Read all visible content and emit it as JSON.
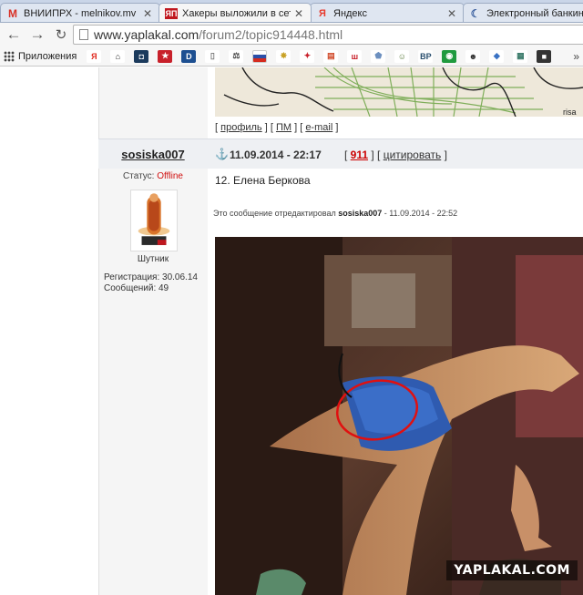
{
  "tabs": [
    {
      "favicon": "gmail-icon",
      "favicon_text": "M",
      "favicon_color": "#d93025",
      "label": "ВНИИПРХ - melnikov.mv",
      "active": false
    },
    {
      "favicon": "yaplakal-icon",
      "favicon_text": "ЯП",
      "favicon_color": "#c0181f",
      "label": "Хакеры выложили в сеть",
      "active": true
    },
    {
      "favicon": "yandex-icon",
      "favicon_text": "Я",
      "favicon_color": "#e83a2d",
      "label": "Яндекс",
      "active": false
    },
    {
      "favicon": "bank-icon",
      "favicon_text": "",
      "favicon_color": "#3a5f9e",
      "label": "Электронный банкинг",
      "active": false
    }
  ],
  "toolbar": {
    "url_host": "www.yaplakal.com",
    "url_path": "/forum2/topic914448.html"
  },
  "bookmarks": {
    "apps_label": "Приложения",
    "items": [
      {
        "icon": "yandex-bookmark-icon",
        "text": "Я",
        "color": "#ffffff",
        "fg": "#e02b20"
      },
      {
        "icon": "home-bookmark-icon",
        "text": "⌂",
        "color": "#ffffff",
        "fg": "#222"
      },
      {
        "icon": "square-bookmark-icon",
        "text": "◘",
        "color": "#1b3a5c",
        "fg": "#fff"
      },
      {
        "icon": "star-bookmark-icon",
        "text": "★",
        "color": "#c8202a",
        "fg": "#fff"
      },
      {
        "icon": "d-bookmark-icon",
        "text": "D",
        "color": "#1d4f91",
        "fg": "#fff"
      },
      {
        "icon": "page-bookmark-icon",
        "text": "▯",
        "color": "#ffffff",
        "fg": "#777"
      },
      {
        "icon": "gavel-bookmark-icon",
        "text": "⚖",
        "color": "#ffffff",
        "fg": "#444"
      },
      {
        "icon": "russia-flag-bookmark-icon",
        "text": "",
        "color": "#3a56a6",
        "fg": "#fff"
      },
      {
        "icon": "emblem-bookmark-icon",
        "text": "✸",
        "color": "#ffffff",
        "fg": "#c9a227"
      },
      {
        "icon": "eagle-bookmark-icon",
        "text": "✦",
        "color": "#ffffff",
        "fg": "#c8202a"
      },
      {
        "icon": "flag-bookmark-icon",
        "text": "▤",
        "color": "#ffffff",
        "fg": "#d04a2a"
      },
      {
        "icon": "w-bookmark-icon",
        "text": "ш",
        "color": "#ffffff",
        "fg": "#c8202a"
      },
      {
        "icon": "shield-bookmark-icon",
        "text": "⬟",
        "color": "#ffffff",
        "fg": "#6c8fbf"
      },
      {
        "icon": "smiley-bookmark-icon",
        "text": "☺",
        "color": "#ffffff",
        "fg": "#5a7a3a"
      },
      {
        "icon": "bp-bookmark-icon",
        "text": "BP",
        "color": "#ffffff",
        "fg": "#2a4f6e"
      },
      {
        "icon": "green-bookmark-icon",
        "text": "◉",
        "color": "#1f9a3f",
        "fg": "#fff"
      },
      {
        "icon": "face-bookmark-icon",
        "text": "☻",
        "color": "#ffffff",
        "fg": "#333"
      },
      {
        "icon": "drop-bookmark-icon",
        "text": "◆",
        "color": "#ffffff",
        "fg": "#3a72c4"
      },
      {
        "icon": "tile-bookmark-icon",
        "text": "▦",
        "color": "#ffffff",
        "fg": "#3a7a6a"
      },
      {
        "icon": "dark-bookmark-icon",
        "text": "■",
        "color": "#333333",
        "fg": "#fff"
      }
    ],
    "more": "»"
  },
  "post": {
    "profile_link": "профиль",
    "pm_link": "ПМ",
    "email_link": "e-mail",
    "username": "sosiska007",
    "datetime": "11.09.2014 - 22:17",
    "post_number": "911",
    "quote_link": "цитировать",
    "status_label": "Статус:",
    "status_value": "Offline",
    "rank": "Шутник",
    "registration": "Регистрация: 30.06.14",
    "messages": "Сообщений: 49",
    "title": "12. Елена Беркова",
    "edited_prefix": "Это сообщение отредактировал",
    "edited_user": "sosiska007",
    "edited_time": "- 11.09.2014 - 22:52",
    "watermark": "YAPLAKAL.COM"
  },
  "colors": {
    "offline": "#d01010",
    "post_number": "#cc0000",
    "annotation_circle": "#e01010"
  }
}
